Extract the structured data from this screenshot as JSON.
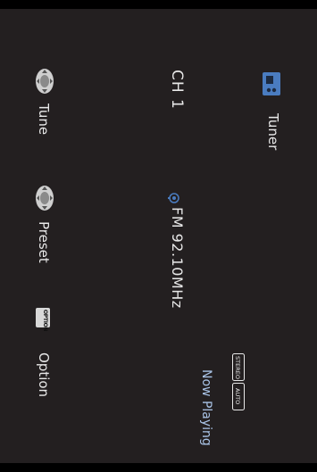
{
  "header": {
    "title": "Tuner",
    "icon": "radio-icon"
  },
  "channel": {
    "label": "CH 1"
  },
  "station": {
    "frequency": "FM 92.10MHz",
    "icon": "antenna-icon"
  },
  "badges": {
    "stereo": "STEREO",
    "auto": "AUTO"
  },
  "status": {
    "now_playing": "Now Playing"
  },
  "controls": {
    "tune": {
      "label": "Tune",
      "icon": "dpad-icon"
    },
    "preset": {
      "label": "Preset",
      "icon": "dpad-icon"
    },
    "option": {
      "key": "OPTION",
      "label": "Option"
    }
  },
  "colors": {
    "background": "#231f20",
    "accent": "#4a7cc0",
    "now_playing": "#a9c3e6"
  }
}
